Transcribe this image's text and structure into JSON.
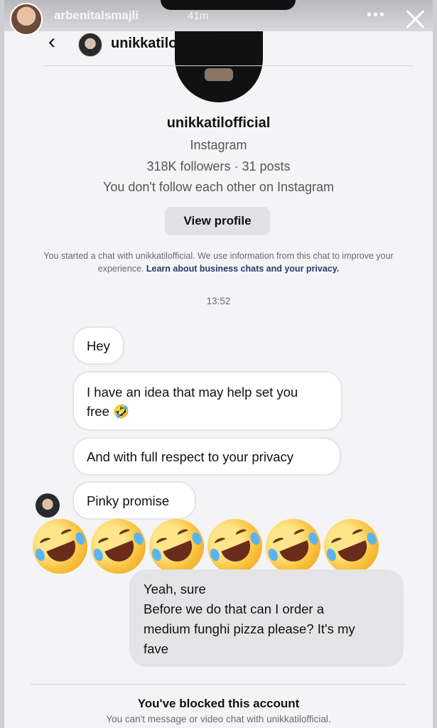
{
  "story": {
    "username": "arbenitalsmajli",
    "time": "41m",
    "more_label": "•••"
  },
  "header": {
    "back_label": "‹",
    "name": "unikkatilofficial"
  },
  "profile": {
    "name": "unikkatilofficial",
    "platform": "Instagram",
    "stats": "318K followers · 31 posts",
    "follow_status": "You don't follow each other on Instagram",
    "view_profile_label": "View profile"
  },
  "disclaimer": {
    "text": "You started a chat with unikkatilofficial. We use information from this chat to improve your experience.",
    "link": "Learn about business chats and your privacy."
  },
  "timestamp": "13:52",
  "messages": {
    "m1": "Hey",
    "m2_line1": "I have an idea that may help set you",
    "m2_line2": "free 🤣",
    "m3": "And with full respect to your privacy",
    "m4": "Pinky promise"
  },
  "emoji_reaction": {
    "icon": "rolling-on-floor-laughing-icon",
    "count": 6
  },
  "reply": {
    "line1": "Yeah, sure",
    "line2": "Before we do that can I order a",
    "line3": "medium funghi pizza  please? It's my",
    "line4": "fave"
  },
  "blocked": {
    "title": "You've blocked this account",
    "subtitle": "You can't message or video chat with unikkatilofficial."
  },
  "colors": {
    "bubble_border": "#e4e4e8",
    "reply_bg": "#e4e4e6",
    "link": "#2a3a6a"
  }
}
